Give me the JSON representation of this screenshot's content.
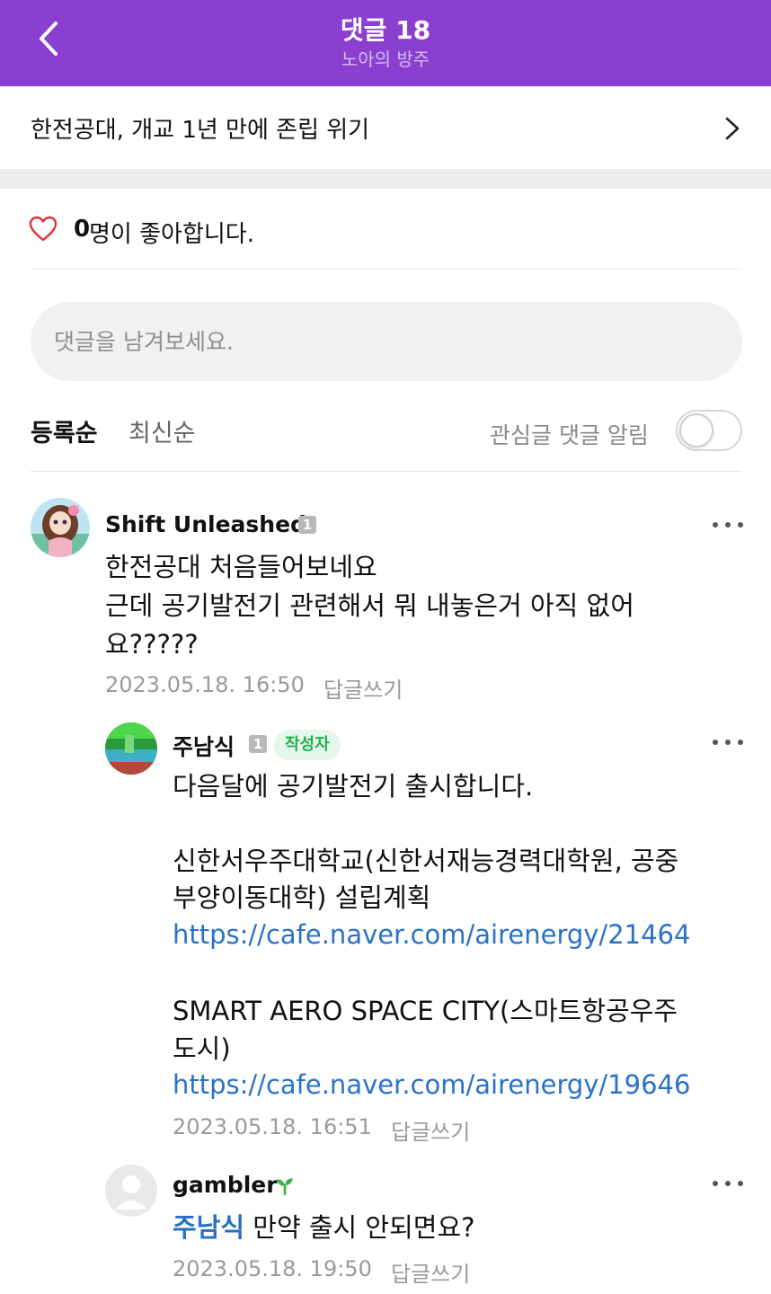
{
  "header": {
    "title": "댓글 18",
    "subtitle": "노아의 방주",
    "bg_color": "#8a3fd0"
  },
  "article": {
    "title": "한전공대, 개교 1년 만에 존립 위기"
  },
  "likes": {
    "count": "0",
    "text": "명이 좋아합니다."
  },
  "comment_input": {
    "placeholder": "댓글을 남겨보세요."
  },
  "sort": {
    "registered": "등록순",
    "latest": "최신순"
  },
  "notify": {
    "label": "관심글 댓글 알림",
    "enabled": false
  },
  "comments": [
    {
      "nick": "Shift Unleashed",
      "level": "1",
      "lines": [
        "한전공대 처음들어보네요",
        "근데 공기발전기 관련해서 뭐 내놓은거 아직 없어",
        "요?????"
      ],
      "date": "2023.05.18. 16:50",
      "reply": "답글쓰기"
    },
    {
      "nick": "주남식",
      "level": "1",
      "badge": "작성자",
      "lines": [
        "다음달에 공기발전기 출시합니다.",
        "신한서우주대학교(신한서재능경력대학원, 공중",
        "부양이동대학) 설립계획",
        "SMART AERO SPACE CITY(스마트항공우주",
        "도시)"
      ],
      "links": [
        "https://cafe.naver.com/airenergy/21464",
        "https://cafe.naver.com/airenergy/19646"
      ],
      "date": "2023.05.18. 16:51",
      "reply": "답글쓰기"
    },
    {
      "nick": "gambler",
      "mention": "주남식",
      "text": "만약 출시 안되면요?",
      "date": "2023.05.18. 19:50",
      "reply": "답글쓰기"
    }
  ]
}
